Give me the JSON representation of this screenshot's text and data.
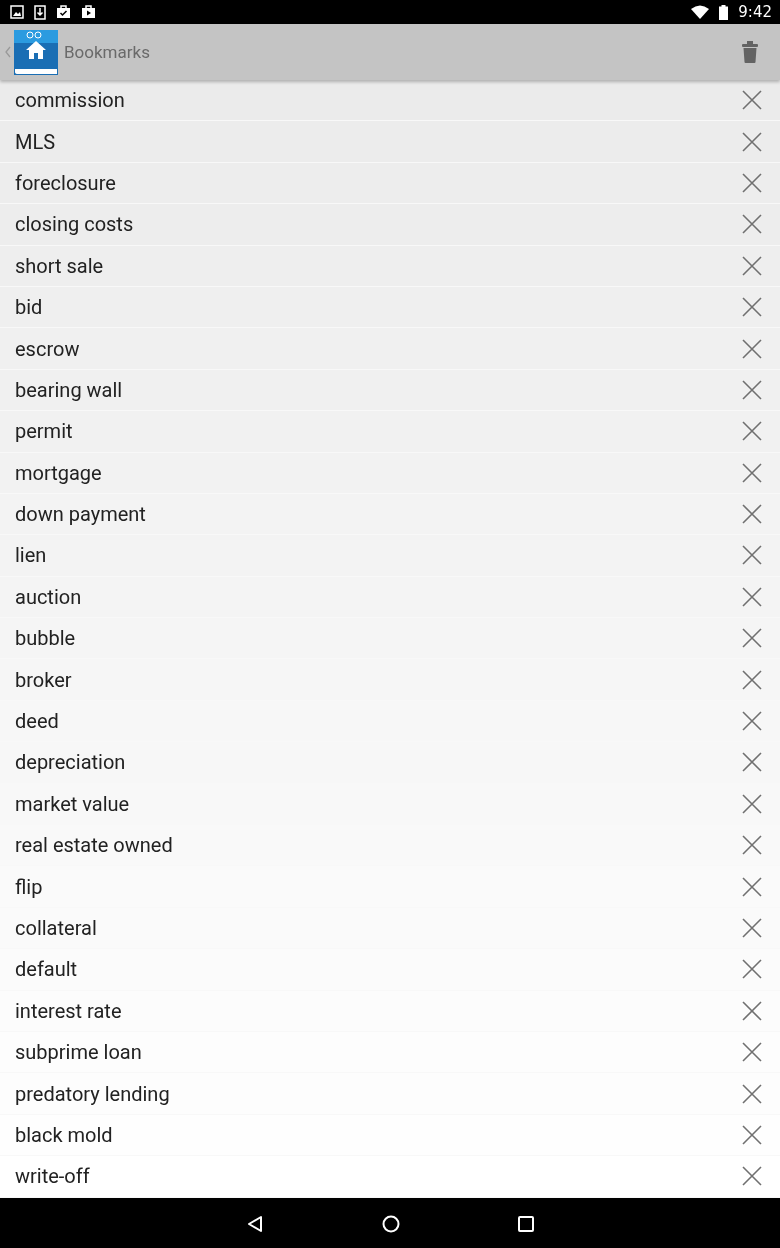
{
  "status_bar": {
    "time": "9:42"
  },
  "header": {
    "title": "Bookmarks"
  },
  "bookmarks": [
    "commission",
    "MLS",
    "foreclosure",
    "closing costs",
    "short sale",
    "bid",
    "escrow",
    "bearing wall",
    "permit",
    "mortgage",
    "down payment",
    "lien",
    "auction",
    "bubble",
    "broker",
    "deed",
    "depreciation",
    "market value",
    "real estate owned",
    "flip",
    "collateral",
    "default",
    "interest rate",
    "subprime loan",
    "predatory lending",
    "black mold",
    "write-off"
  ]
}
